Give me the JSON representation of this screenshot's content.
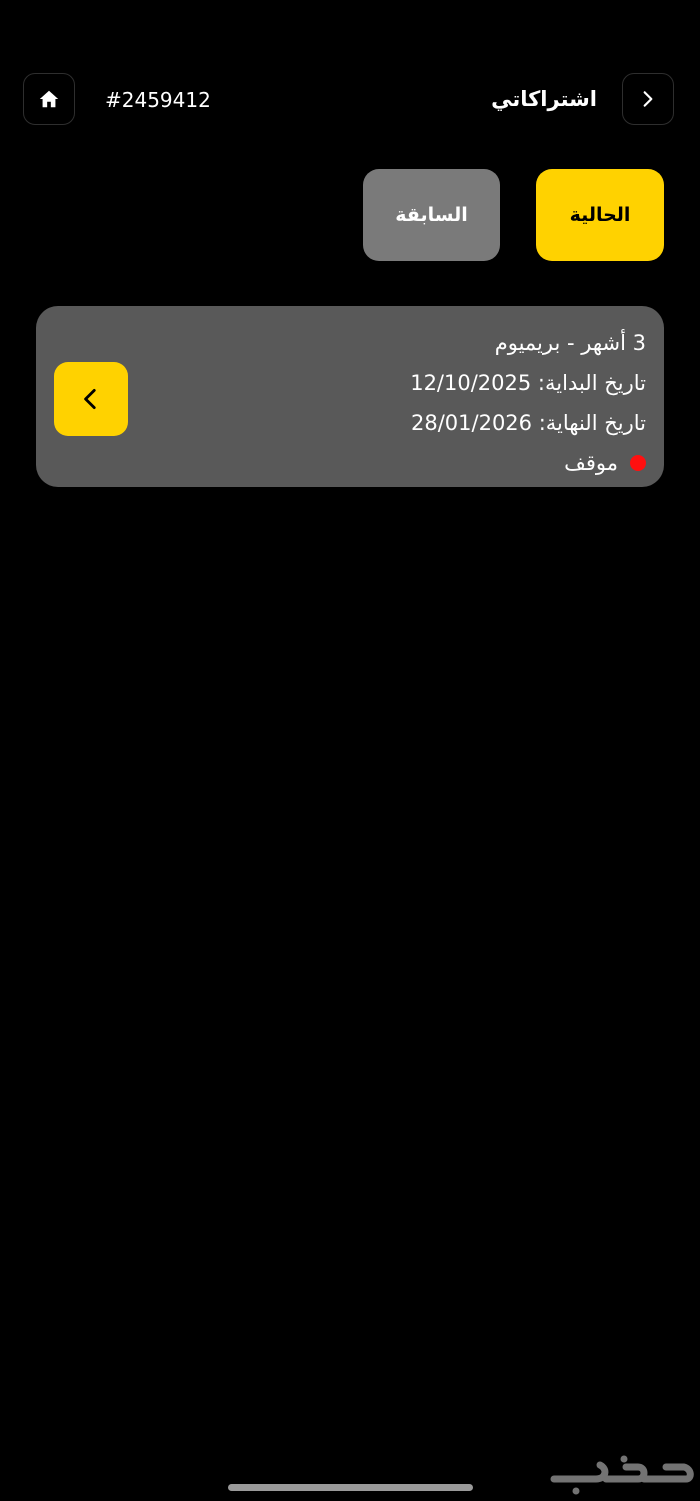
{
  "header": {
    "title": "اشتراكاتي",
    "order_id": "#2459412",
    "home_icon": "home-icon",
    "back_icon": "chevron-right-icon"
  },
  "tabs": [
    {
      "label": "الحالية",
      "active": true
    },
    {
      "label": "السابقة",
      "active": false
    }
  ],
  "subscriptions": [
    {
      "plan": "3 أشهر - بريميوم",
      "start_date": "تاريخ البداية: 12/10/2025",
      "end_date": "تاريخ النهاية: 28/01/2026",
      "status": "موقف",
      "action_icon": "chevron-left-icon"
    }
  ],
  "watermark": {
    "text": "حراج"
  },
  "colors": {
    "accent": "#FFD200",
    "background": "#000000",
    "card": "#595959",
    "tab_inactive": "#7A7A7A",
    "status_stopped": "#FF1010",
    "home_indicator": "#9A9A9A"
  }
}
